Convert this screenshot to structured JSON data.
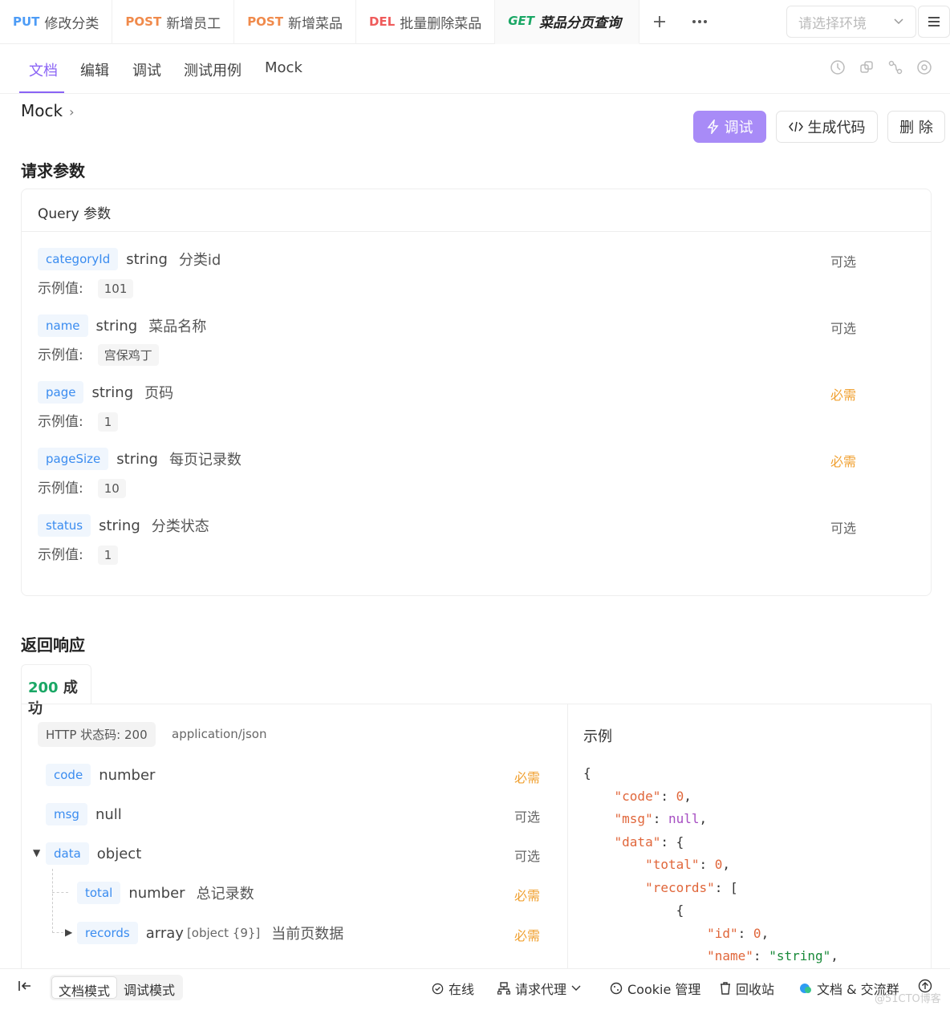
{
  "request_tabs": [
    {
      "method": "PUT",
      "name": "修改分类"
    },
    {
      "method": "POST",
      "name": "新增员工"
    },
    {
      "method": "POST",
      "name": "新增菜品"
    },
    {
      "method": "DEL",
      "name": "批量删除菜品"
    },
    {
      "method": "GET",
      "name": "菜品分页查询",
      "active": true
    }
  ],
  "env_placeholder": "请选择环境",
  "subtabs": [
    "文档",
    "编辑",
    "调试",
    "测试用例",
    "Mock"
  ],
  "breadcrumb": "Mock",
  "actions": {
    "debug": "调试",
    "gen_code": "生成代码",
    "delete": "删 除"
  },
  "request_section_title": "请求参数",
  "query_card_title": "Query 参数",
  "example_label": "示例值:",
  "params": [
    {
      "name": "categoryId",
      "type": "string",
      "desc": "分类id",
      "required": "可选",
      "example": "101"
    },
    {
      "name": "name",
      "type": "string",
      "desc": "菜品名称",
      "required": "可选",
      "example": "宫保鸡丁"
    },
    {
      "name": "page",
      "type": "string",
      "desc": "页码",
      "required": "必需",
      "example": "1"
    },
    {
      "name": "pageSize",
      "type": "string",
      "desc": "每页记录数",
      "required": "必需",
      "example": "10"
    },
    {
      "name": "status",
      "type": "string",
      "desc": "分类状态",
      "required": "可选",
      "example": "1"
    }
  ],
  "response_section_title": "返回响应",
  "response_tab": {
    "code": "200",
    "label": "成功"
  },
  "http_status": "HTTP 状态码: 200",
  "content_type": "application/json",
  "response_fields": [
    {
      "name": "code",
      "type": "number",
      "desc": "",
      "required": "必需"
    },
    {
      "name": "msg",
      "type": "null",
      "desc": "",
      "required": "可选"
    },
    {
      "name": "data",
      "type": "object",
      "desc": "",
      "required": "可选"
    },
    {
      "name": "total",
      "type": "number",
      "desc": "总记录数",
      "required": "必需"
    },
    {
      "name": "records",
      "type": "array",
      "type_detail": "[object {9}]",
      "desc": "当前页数据",
      "required": "必需"
    }
  ],
  "example_title": "示例",
  "bottom": {
    "doc_mode": "文档模式",
    "debug_mode": "调试模式",
    "online": "在线",
    "proxy": "请求代理",
    "cookie": "Cookie 管理",
    "recycle": "回收站",
    "community": "文档 & 交流群"
  },
  "watermark": "@51CTO博客"
}
